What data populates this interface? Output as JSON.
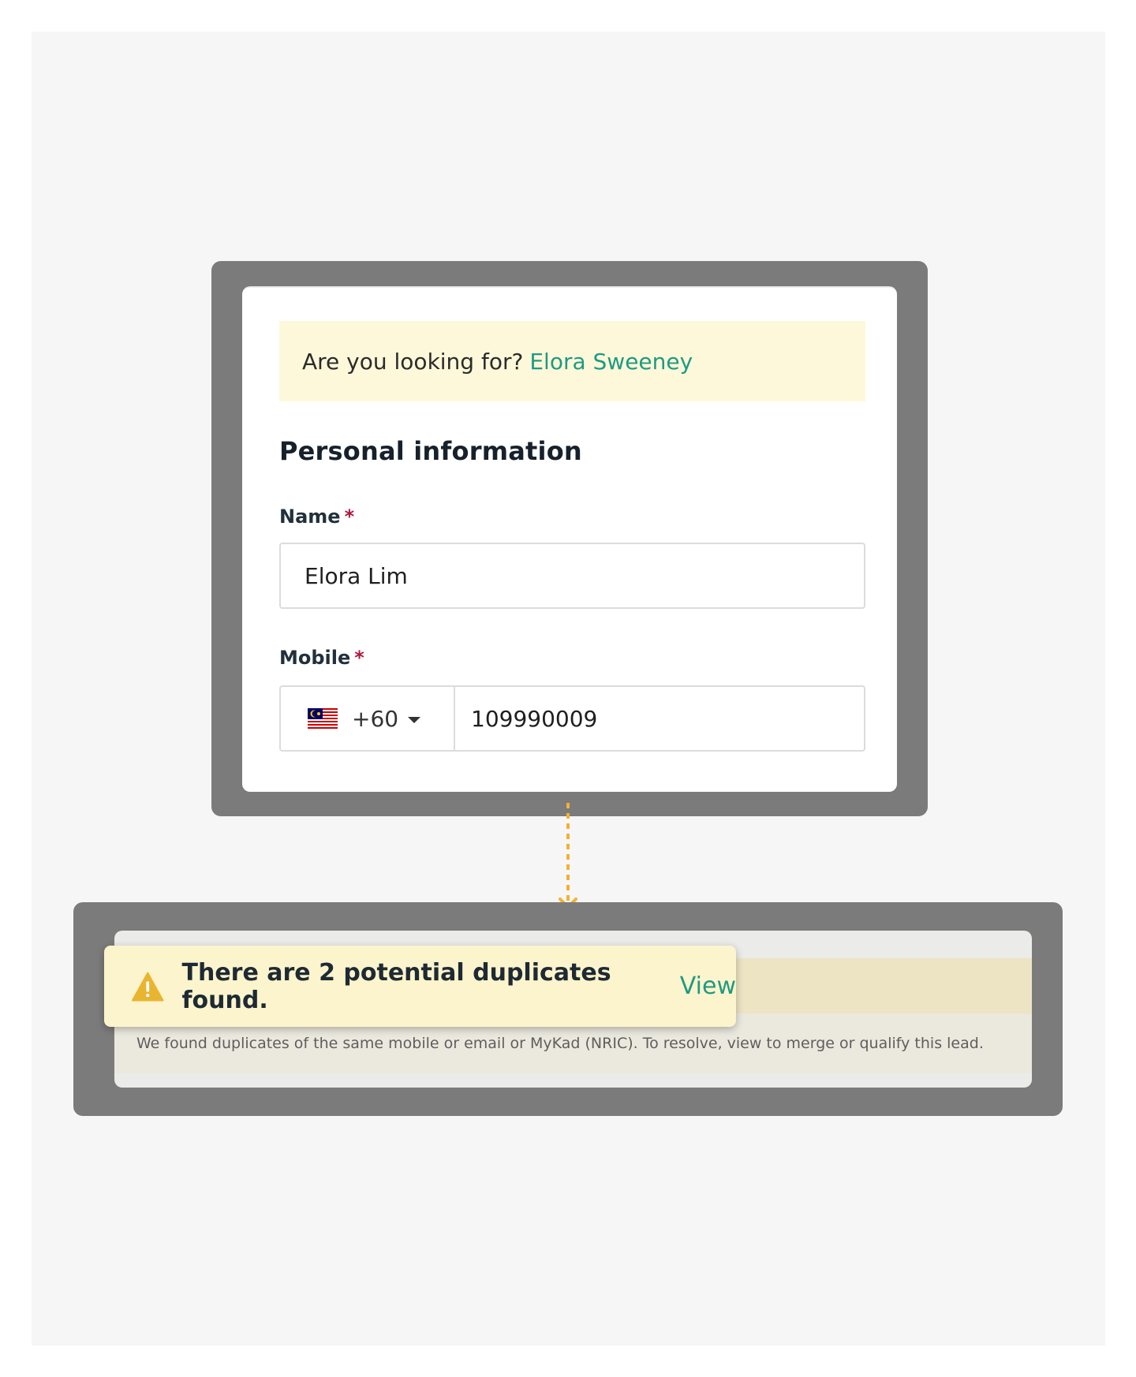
{
  "suggestion": {
    "question": "Are you looking for?",
    "link_text": "Elora Sweeney"
  },
  "section": {
    "title": "Personal information"
  },
  "name_field": {
    "label": "Name",
    "required_mark": "*",
    "value": "Elora Lim"
  },
  "mobile_field": {
    "label": "Mobile",
    "required_mark": "*",
    "country_flag": "malaysia-flag-icon",
    "country_code": "+60",
    "value": "109990009"
  },
  "duplicate_alert": {
    "message": "There are 2 potential duplicates found.",
    "link_text": "View",
    "description": "We found duplicates of the same mobile or email or MyKad (NRIC). To resolve, view to merge or qualify this lead."
  },
  "colors": {
    "accent_link": "#1f9a84",
    "required": "#b0173a",
    "warning": "#e9b530",
    "arrow": "#f2b233"
  }
}
